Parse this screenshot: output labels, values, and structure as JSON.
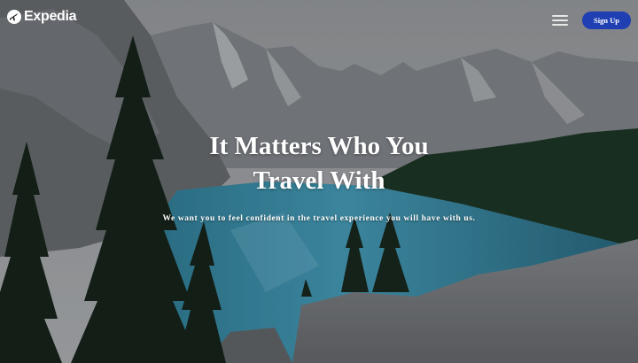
{
  "brand": {
    "name": "Expedia",
    "logo_icon": "plane-globe-icon"
  },
  "nav": {
    "menu_icon": "hamburger-menu-icon",
    "signup_label": "Sign Up"
  },
  "hero": {
    "headline_line1": "It Matters Who You",
    "headline_line2": "Travel With",
    "tagline": "We want you to feel confident in the travel experience you will have with us.",
    "background": "mountain-lake-photo"
  },
  "colors": {
    "accent": "#1f3fb3",
    "text": "#ffffff",
    "sky": "#a7abb0",
    "lake": "#3f9ab8"
  }
}
